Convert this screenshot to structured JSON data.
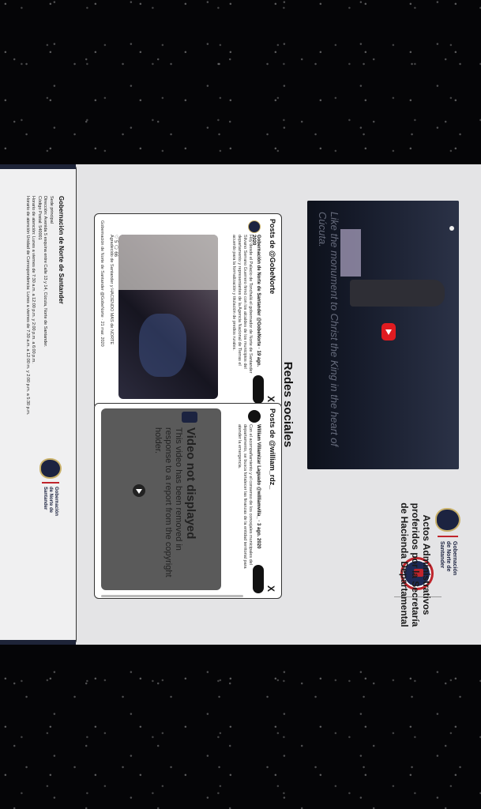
{
  "header": {
    "gov_logo_lines": [
      "Gobernación",
      "de Norte de",
      "Santander"
    ],
    "acts_title": "Actos Administrativos proferidos por la Secretaría de Hacienda Departamental"
  },
  "hero": {
    "caption": "Like the monument to Christ the King in the heart of Cúcuta.",
    "play_icon": "youtube-play-icon"
  },
  "social": {
    "title": "Redes sociales",
    "card_left": {
      "title": "Posts de @GobeNorte",
      "user": "Gobernación de Norte de Santander @GobeNorte · 19 ago. 2020",
      "text": "Hoy desde el Palacio de Tonchalá el gobernador de Norte de Santander Silvano Serrano Guerrero firmó con los alcaldes de los municipios del departamento y representantes de la Agencia Nacional de Tierras el acuerdo para la formalización y titulación de predios rurales.",
      "stats": "♡ 5  🗨 66",
      "meta": "Agradecido de Santander y HACIENDO MAS de NORTE",
      "meta2": "Gobernación de Norte de Santander @GobeNorte · 21 mar. 2020"
    },
    "card_right": {
      "title": "Posts de @william_rdz_",
      "user": "William Villamizar Laguado @williamvilla_ · 3 ago. 2020",
      "text": "Con el acompañamiento y el consenso de los concejales municipales del departamento, se busca fortalecer las finanzas de la entidad territorial para atender la emergencia.",
      "video_title": "Video not displayed",
      "video_sub": "This video has been removed in response to a report from the copyright holder."
    }
  },
  "footer": {
    "org_name": "Gobernación de Norte de Santander",
    "lines": [
      "Sede principal",
      "Dirección: Avenida 5 esquina entre Calle 13 y 14, Cúcuta, Norte de Santander.",
      "Código Postal: 540001",
      "Horario de atención: Lunes a viernes de 7:30 a.m. a 12:00 p.m. y 2:00 p.m. a 6:00 p.m.",
      "Horario de atención Unidad de Correspondencia: Lunes a viernes de 7:30 a.m. a 12:00 m. y 2:00 p.m. a 5:30 p.m."
    ],
    "logo_lines": [
      "Gobernación",
      "de Norte de",
      "Santander"
    ]
  },
  "colors": {
    "brand_navy": "#1c2340",
    "brand_red": "#c0252c",
    "page_bg": "#e4e4e6"
  }
}
